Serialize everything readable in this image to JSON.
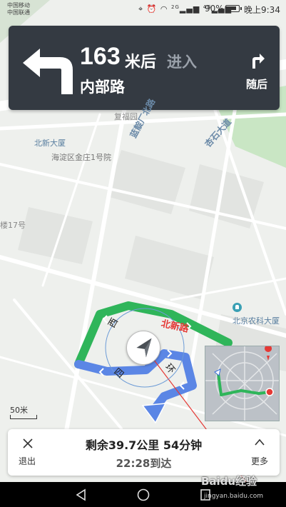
{
  "status_bar": {
    "carrier_1": "中国移动",
    "carrier_2": "中国联通",
    "icons": [
      "location-icon",
      "alarm-icon",
      "wifi-icon",
      "signal-icon",
      "signal-icon"
    ],
    "network_1": "2G",
    "network_2": "4G",
    "battery_percent": "90%",
    "battery_level": 0.9,
    "time": "晚上9:34"
  },
  "nav_card": {
    "distance_value": "163",
    "distance_unit": "米后",
    "action": "进入",
    "road_name": "内部路",
    "next_label": "随后",
    "turn_icon": "turn-left-icon",
    "next_turn_icon": "turn-right-icon"
  },
  "map": {
    "labels": {
      "bldg_north_new": "北新大厦",
      "addr_jinzhuang": "海淀区金庄1号院",
      "street_fuhe": "复福园",
      "road_lanxianglu": "蓝靛厂北路",
      "road_xingshi": "杏石大道",
      "bldg_17": "楼17号",
      "road_beixinlu": "北新路",
      "road_xi": "西",
      "road_si": "四",
      "road_huan": "环",
      "bldg_nongke": "北京农科大厦"
    },
    "scale_label": "50米"
  },
  "bottom_panel": {
    "exit_label": "退出",
    "remaining": "剩余39.7公里 54分钟",
    "arrival": "22:28到达",
    "more_label": "更多"
  },
  "watermark": {
    "main": "Baidu经验",
    "sub": "jingyan.baidu.com"
  },
  "colors": {
    "route_green": "#2fb55a",
    "route_blue": "#5b86e5",
    "nav_card_bg": "#343a42",
    "direction_line": "#e53935"
  }
}
